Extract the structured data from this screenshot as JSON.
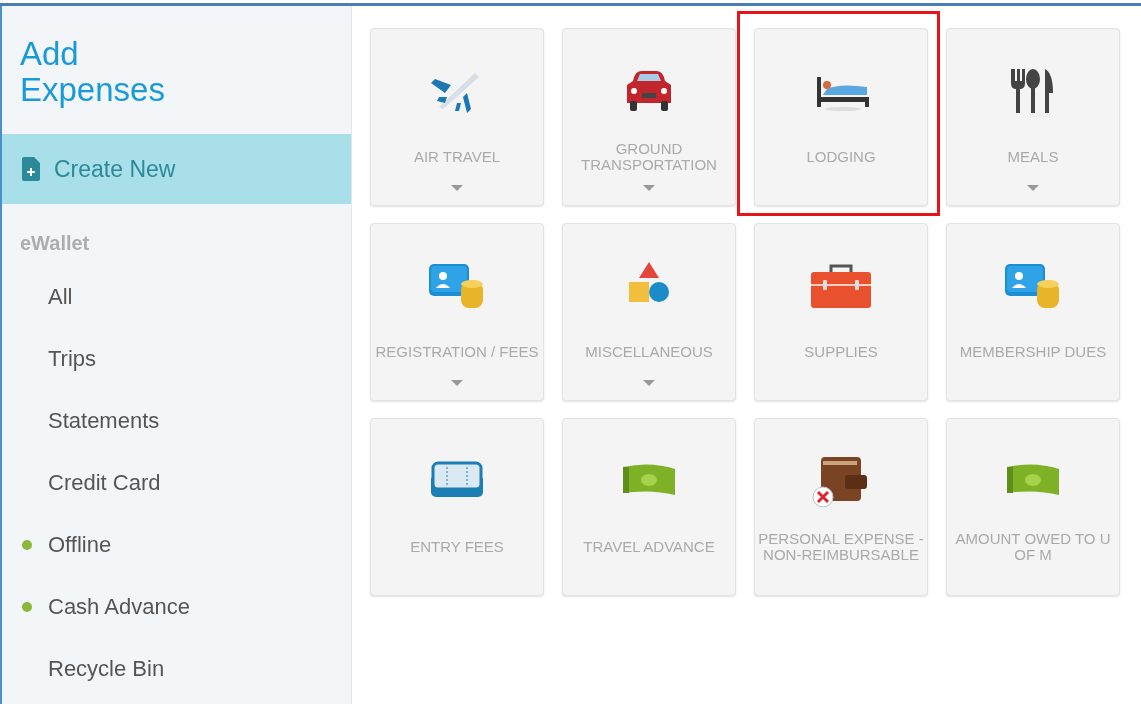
{
  "sidebar": {
    "title": "Add Expenses",
    "create_button": {
      "label": "Create New",
      "selected": true
    },
    "section_label": "eWallet",
    "items": [
      {
        "label": "All"
      },
      {
        "label": "Trips"
      },
      {
        "label": "Statements"
      },
      {
        "label": "Credit Card"
      },
      {
        "label": "Offline",
        "color": "#8ab83a"
      },
      {
        "label": "Cash Advance",
        "color": "#8ab83a"
      },
      {
        "label": "Recycle Bin"
      }
    ]
  },
  "tiles": [
    {
      "label": "AIR TRAVEL",
      "kind": "plane",
      "has_menu": true,
      "highlighted": false
    },
    {
      "label": "GROUND TRANSPORTATION",
      "kind": "car",
      "has_menu": true,
      "highlighted": false
    },
    {
      "label": "LODGING",
      "kind": "bed",
      "has_menu": false,
      "highlighted": true
    },
    {
      "label": "MEALS",
      "kind": "utensils",
      "has_menu": true,
      "highlighted": false
    },
    {
      "label": "REGISTRATION / FEES",
      "kind": "idcard",
      "has_menu": true,
      "highlighted": false
    },
    {
      "label": "MISCELLANEOUS",
      "kind": "shapes",
      "has_menu": true,
      "highlighted": false
    },
    {
      "label": "SUPPLIES",
      "kind": "toolbox",
      "has_menu": false,
      "highlighted": false
    },
    {
      "label": "MEMBERSHIP DUES",
      "kind": "idcard",
      "has_menu": false,
      "highlighted": false
    },
    {
      "label": "ENTRY FEES",
      "kind": "ticket",
      "has_menu": false,
      "highlighted": false
    },
    {
      "label": "TRAVEL ADVANCE",
      "kind": "money",
      "has_menu": false,
      "highlighted": false
    },
    {
      "label": "PERSONAL EXPENSE - NON-REIMBURSABLE",
      "kind": "wallet",
      "has_menu": false,
      "highlighted": false
    },
    {
      "label": "AMOUNT OWED TO U OF M",
      "kind": "money",
      "has_menu": false,
      "highlighted": false
    }
  ]
}
